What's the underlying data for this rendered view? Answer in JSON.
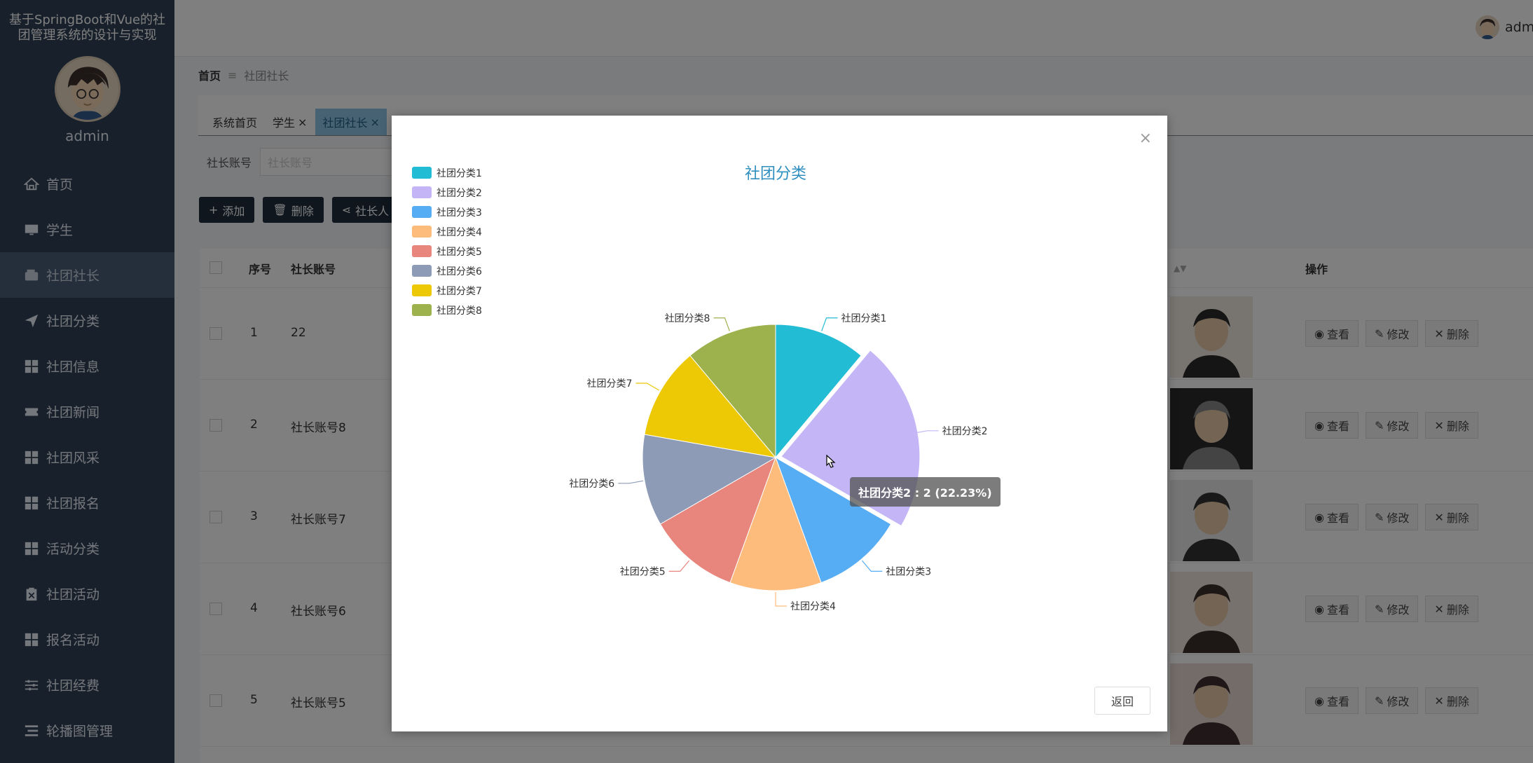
{
  "sidebar": {
    "system_title": "基于SpringBoot和Vue的社团管理系统的设计与实现",
    "admin_name": "admin",
    "items": [
      {
        "label": "首页",
        "icon": "home-icon"
      },
      {
        "label": "学生",
        "icon": "monitor-icon"
      },
      {
        "label": "社团社长",
        "icon": "wallet-icon",
        "active": true
      },
      {
        "label": "社团分类",
        "icon": "send-icon"
      },
      {
        "label": "社团信息",
        "icon": "grid-icon"
      },
      {
        "label": "社团新闻",
        "icon": "ticket-icon"
      },
      {
        "label": "社团风采",
        "icon": "grid-icon"
      },
      {
        "label": "社团报名",
        "icon": "grid-icon"
      },
      {
        "label": "活动分类",
        "icon": "grid-icon"
      },
      {
        "label": "社团活动",
        "icon": "clipboard-icon"
      },
      {
        "label": "报名活动",
        "icon": "grid-icon"
      },
      {
        "label": "社团经费",
        "icon": "sliders-icon"
      },
      {
        "label": "轮播图管理",
        "icon": "list-icon"
      }
    ]
  },
  "topbar": {
    "user": "adm"
  },
  "breadcrumb": {
    "home": "首页",
    "separator": "≡",
    "current": "社团社长"
  },
  "tabs": [
    {
      "label": "系统首页",
      "closable": false
    },
    {
      "label": "学生",
      "closable": true
    },
    {
      "label": "社团社长",
      "closable": true,
      "active": true
    }
  ],
  "search": {
    "label": "社长账号",
    "placeholder": "社长账号"
  },
  "buttons": {
    "add": "添加",
    "delete": "删除",
    "stats": "社长人"
  },
  "table": {
    "headers": {
      "seq": "序号",
      "account": "社长账号",
      "ops": "操作"
    },
    "rows": [
      {
        "seq": "1",
        "account": "22"
      },
      {
        "seq": "2",
        "account": "社长账号8"
      },
      {
        "seq": "3",
        "account": "社长账号7"
      },
      {
        "seq": "4",
        "account": "社长账号6"
      },
      {
        "seq": "5",
        "account": "社长账号5"
      }
    ],
    "op_labels": {
      "view": "查看",
      "edit": "修改",
      "delete": "删除"
    }
  },
  "dialog": {
    "close_symbol": "×",
    "return_label": "返回",
    "tooltip": "社团分类2 : 2 (22.23%)"
  },
  "chart_data": {
    "type": "pie",
    "title": "社团分类",
    "legend_position": "top-left",
    "slices": [
      {
        "name": "社团分类1",
        "value": 1,
        "color": "#22bcd4"
      },
      {
        "name": "社团分类2",
        "value": 2,
        "color": "#c4b6f6"
      },
      {
        "name": "社团分类3",
        "value": 1,
        "color": "#57adf4"
      },
      {
        "name": "社团分类4",
        "value": 1,
        "color": "#fdbc7c"
      },
      {
        "name": "社团分类5",
        "value": 1,
        "color": "#e8857c"
      },
      {
        "name": "社团分类6",
        "value": 1,
        "color": "#8e9bb6"
      },
      {
        "name": "社团分类7",
        "value": 1,
        "color": "#edc804"
      },
      {
        "name": "社团分类8",
        "value": 1,
        "color": "#9db14d"
      }
    ],
    "highlighted": "社团分类2"
  }
}
